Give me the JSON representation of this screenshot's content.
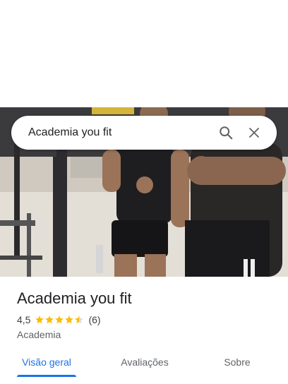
{
  "search": {
    "value": "Academia you fit"
  },
  "place": {
    "name": "Academia you fit",
    "rating": "4,5",
    "rating_fraction": 0.9,
    "review_count": "(6)",
    "category": "Academia"
  },
  "tabs": [
    {
      "label": "Visão geral",
      "active": true
    },
    {
      "label": "Avaliações",
      "active": false
    },
    {
      "label": "Sobre",
      "active": false
    }
  ],
  "colors": {
    "accent": "#1a73e8",
    "star": "#fbbc04",
    "star_empty": "#dadce0"
  },
  "icons": {
    "search": "search-icon",
    "close": "close-icon",
    "star": "star-icon"
  }
}
